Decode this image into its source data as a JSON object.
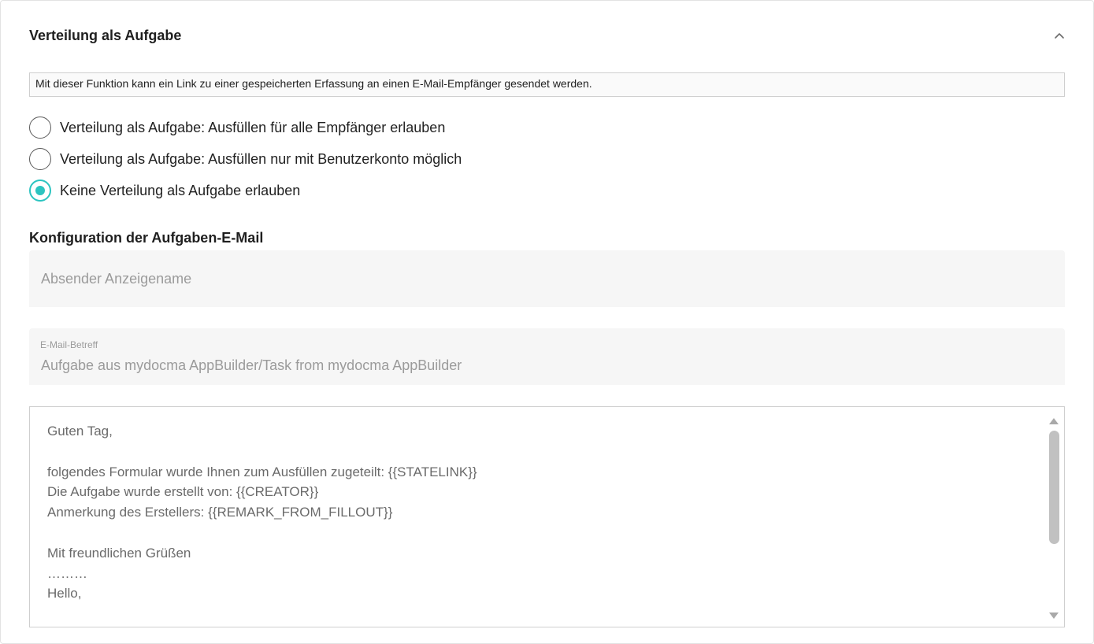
{
  "section": {
    "title": "Verteilung als Aufgabe",
    "collapse_icon": "chevron-up-icon"
  },
  "info_text": "Mit dieser Funktion kann ein Link zu einer gespeicherten Erfassung an einen E-Mail-Empfänger gesendet werden.",
  "distribution_options": [
    {
      "label": "Verteilung als Aufgabe: Ausfüllen für alle Empfänger erlauben",
      "selected": false
    },
    {
      "label": "Verteilung als Aufgabe: Ausfüllen nur mit Benutzerkonto möglich",
      "selected": false
    },
    {
      "label": "Keine Verteilung als Aufgabe erlauben",
      "selected": true
    }
  ],
  "email_config": {
    "title": "Konfiguration der Aufgaben-E-Mail",
    "sender_name": {
      "placeholder": "Absender Anzeigename",
      "value": ""
    },
    "subject": {
      "label": "E-Mail-Betreff",
      "value": "Aufgabe aus mydocma AppBuilder/Task from mydocma AppBuilder"
    },
    "body": "Guten Tag,\n\nfolgendes Formular wurde Ihnen zum Ausfüllen zugeteilt: {{STATELINK}}\nDie Aufgabe wurde erstellt von: {{CREATOR}}\nAnmerkung des Erstellers: {{REMARK_FROM_FILLOUT}}\n\nMit freundlichen Grüßen\n………\nHello,"
  },
  "colors": {
    "accent": "#2cc4c0",
    "field_bg": "#f6f6f6",
    "muted_text": "#9b9b9b"
  }
}
